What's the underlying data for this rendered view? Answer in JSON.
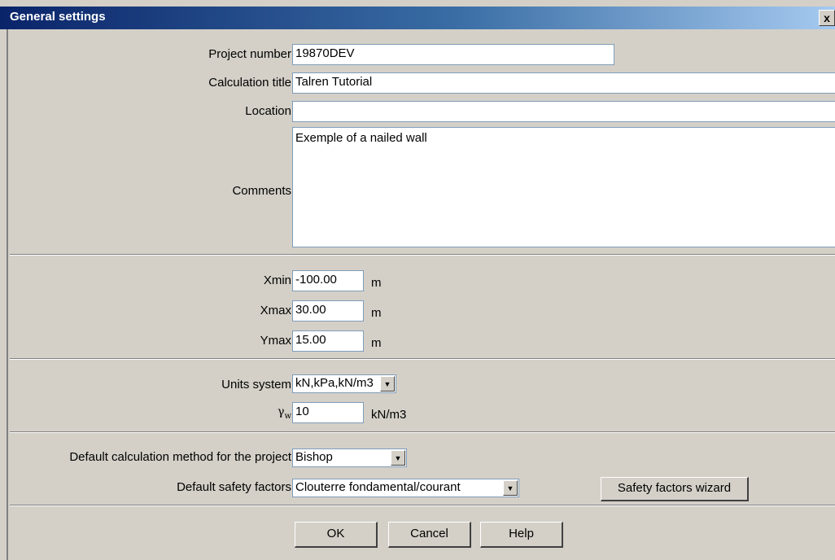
{
  "window": {
    "title": "General settings",
    "close_label": "x"
  },
  "project": {
    "project_number_label": "Project number",
    "project_number_value": "19870DEV",
    "calc_title_label": "Calculation title",
    "calc_title_value": "Talren Tutorial",
    "location_label": "Location",
    "location_value": "",
    "comments_label": "Comments",
    "comments_value": "Exemple of a nailed wall"
  },
  "extents": {
    "xmin_label": "Xmin",
    "xmin_value": "-100.00",
    "xmax_label": "Xmax",
    "xmax_value": "30.00",
    "ymax_label": "Ymax",
    "ymax_value": "15.00",
    "unit": "m"
  },
  "units": {
    "system_label": "Units system",
    "system_value": "kN,kPa,kN/m3",
    "gamma_symbol": "γ",
    "gamma_sub": "w",
    "gamma_value": "10",
    "gamma_unit": "kN/m3"
  },
  "method": {
    "method_label": "Default calculation method for the project",
    "method_value": "Bishop",
    "safety_label": "Default safety factors",
    "safety_value": "Clouterre fondamental/courant",
    "wizard_button": "Safety factors wizard"
  },
  "buttons": {
    "ok": "OK",
    "cancel": "Cancel",
    "help": "Help"
  }
}
